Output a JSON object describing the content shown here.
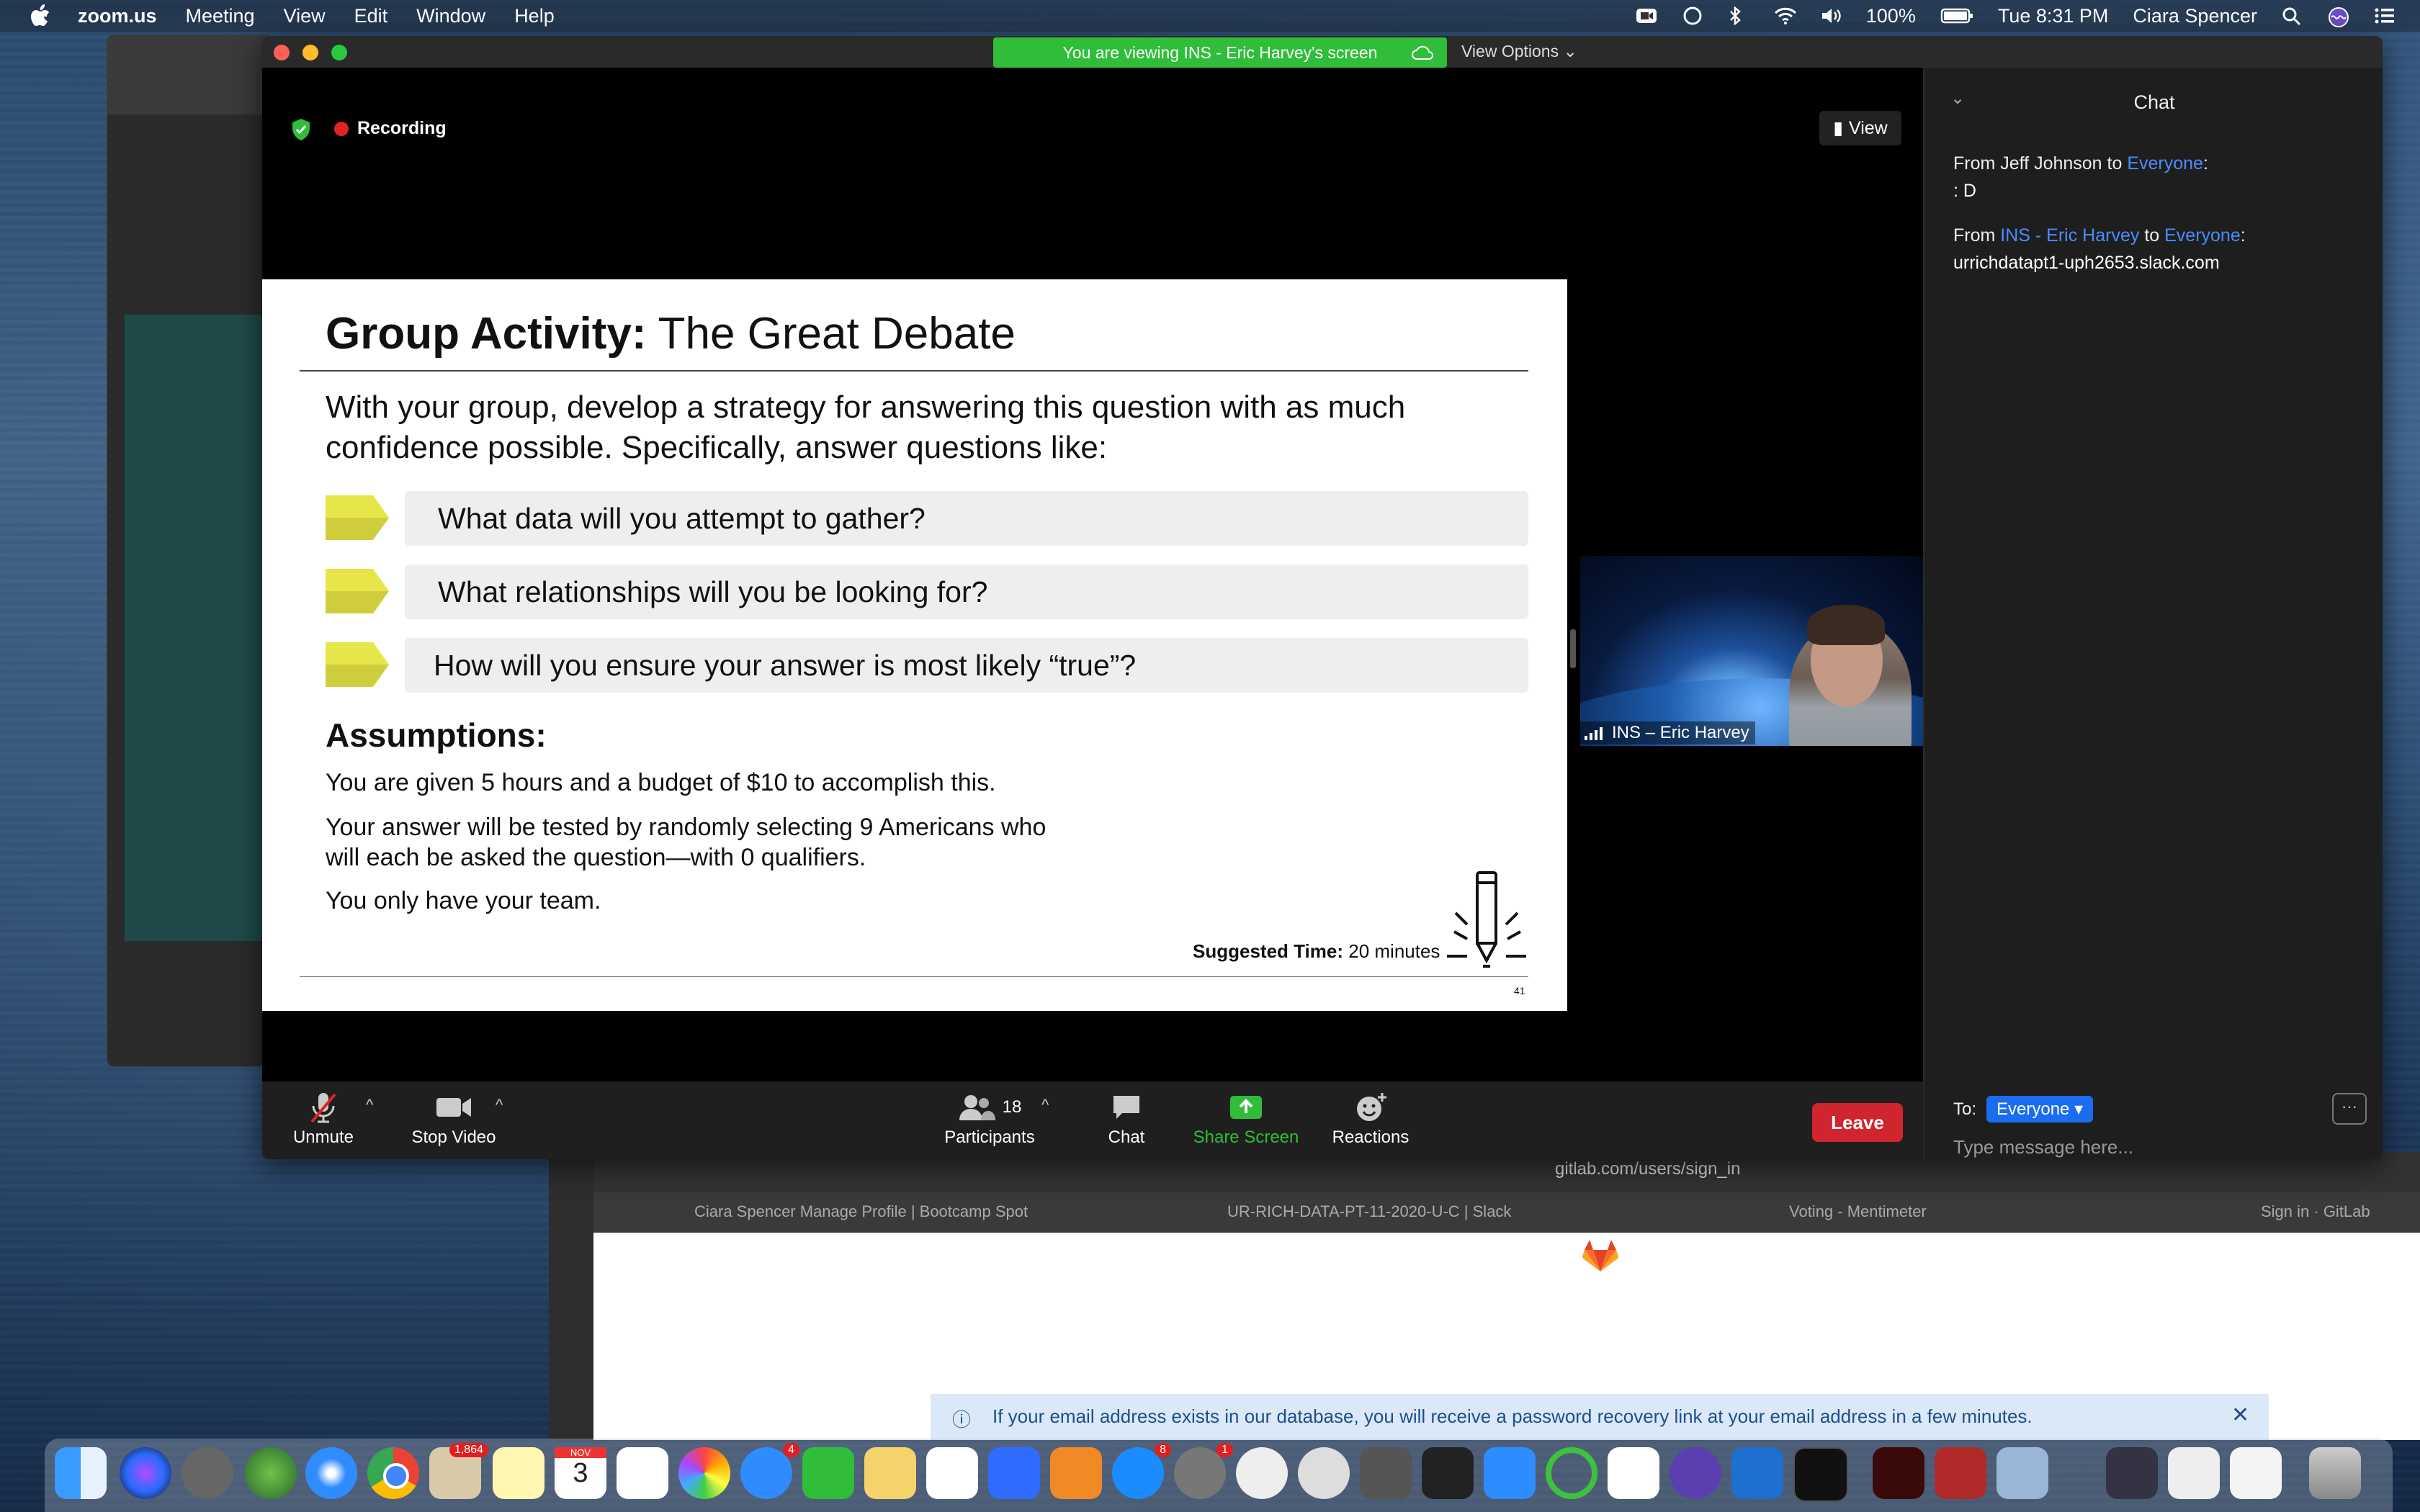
{
  "menubar": {
    "app": "zoom.us",
    "items": [
      "Meeting",
      "View",
      "Edit",
      "Window",
      "Help"
    ],
    "battery": "100%",
    "clock": "Tue 8:31 PM",
    "user": "Ciara Spencer"
  },
  "browser": {
    "url": "gitlab.com/users/sign_in",
    "tabs": [
      "Ciara Spencer Manage Profile | Bootcamp Spot",
      "UR-RICH-DATA-PT-11-2020-U-C | Slack",
      "Voting - Mentimeter",
      "Sign in · GitLab"
    ],
    "notice": "If your email address exists in our database, you will receive a password recovery link at your email address in a few minutes."
  },
  "zoom": {
    "viewing_banner": "You are viewing INS - Eric Harvey's screen",
    "view_options": "View Options",
    "recording": "Recording",
    "view_button": "View",
    "video_name": "INS – Eric Harvey"
  },
  "slide": {
    "title_bold": "Group Activity:",
    "title_rest": "The Great Debate",
    "intro": "With your group, develop a strategy for answering this question with as much confidence possible. Specifically, answer questions like:",
    "questions": [
      "What data will you attempt to gather?",
      "What relationships will you be looking for?",
      "How will you ensure your answer is most likely “true”?"
    ],
    "assumptions_heading": "Assumptions:",
    "assumptions": [
      "You are given 5 hours and a budget of $10 to accomplish this.",
      "Your answer will be tested by randomly selecting 9 Americans who will each be asked the question—with 0 qualifiers.",
      "You only have your team."
    ],
    "suggested_label": "Suggested Time:",
    "suggested_value": "20 minutes",
    "page_number": "41"
  },
  "toolbar": {
    "unmute": "Unmute",
    "stop_video": "Stop Video",
    "participants": "Participants",
    "participants_count": "18",
    "chat": "Chat",
    "share_screen": "Share Screen",
    "reactions": "Reactions",
    "leave": "Leave"
  },
  "chat": {
    "title": "Chat",
    "messages": [
      {
        "from": "Jeff Johnson",
        "to": "Everyone",
        "text": ": D"
      },
      {
        "from": "INS - Eric Harvey",
        "to": "Everyone",
        "text": "urrichdatapt1-uph2653.slack.com"
      }
    ],
    "to_label": "To:",
    "recipient": "Everyone",
    "placeholder": "Type message here..."
  },
  "dock": {
    "badges": {
      "mail": "1,864",
      "messages": "4",
      "appstore": "8",
      "prefs": "1"
    },
    "calendar_month": "NOV",
    "calendar_day": "3"
  },
  "colors": {
    "zoom_green": "#2fbd3a",
    "leave_red": "#d0242f",
    "chat_link_blue": "#4a8cff",
    "arrow_yellow": "#e6e64a"
  }
}
